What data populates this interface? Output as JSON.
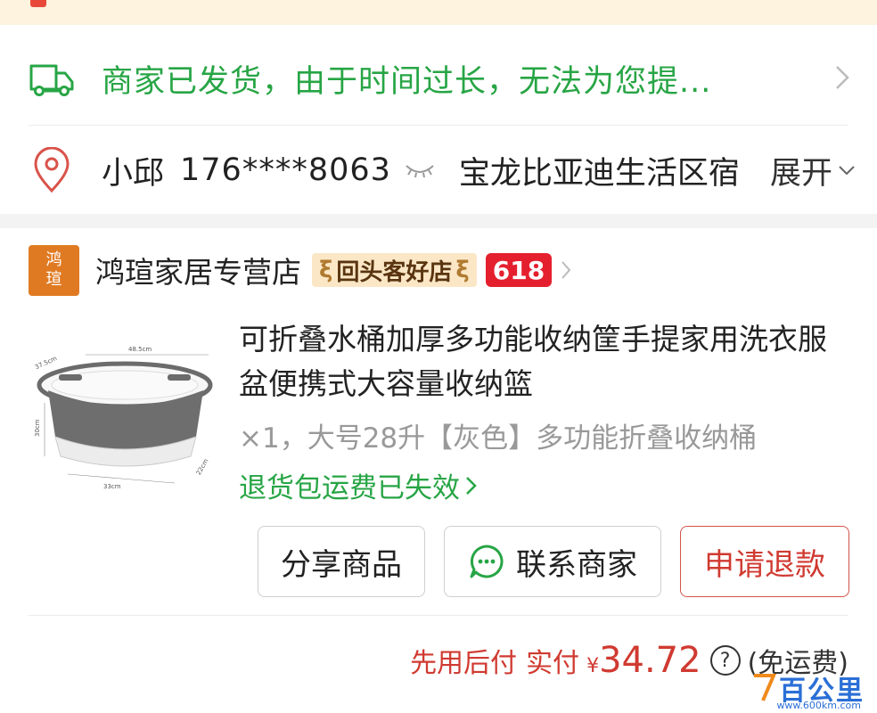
{
  "shipping": {
    "icon": "truck-icon",
    "status_text": "商家已发货，由于时间过长，无法为您提...",
    "color": "#27a545"
  },
  "address": {
    "icon": "location-pin-icon",
    "name": "小邱",
    "phone": "176****8063",
    "address_text": "宝龙比亚迪生活区宿",
    "expand_label": "展开"
  },
  "store": {
    "logo_text_top": "鸿",
    "logo_text_bottom": "瑄",
    "name": "鸿瑄家居专营店",
    "badge_returning": "回头客好店",
    "badge_618": "618"
  },
  "product": {
    "title": "可折叠水桶加厚多功能收纳筐手提家用洗衣服盆便携式大容量收纳篮",
    "sku": "×1，大号28升【灰色】多功能折叠收纳桶",
    "return_shipping": "退货包运费已失效",
    "image_dims": {
      "top_width": "48.5cm",
      "side_depth": "37.5cm",
      "height": "30cm",
      "bottom_width": "33cm",
      "bottom_depth": "22cm"
    }
  },
  "actions": {
    "share_label": "分享商品",
    "contact_label": "联系商家",
    "refund_label": "申请退款"
  },
  "payment": {
    "pay_later": "先用后付",
    "paid_label": "实付",
    "currency": "¥",
    "amount": "34.72",
    "help_icon": "?",
    "shipping_note": "(免运费)"
  },
  "watermark": {
    "text": "百公里",
    "url": "www.600km.com"
  },
  "colors": {
    "green": "#27a545",
    "red": "#d03a31",
    "brand_618": "#e5202e",
    "store_logo": "#e07a22"
  }
}
